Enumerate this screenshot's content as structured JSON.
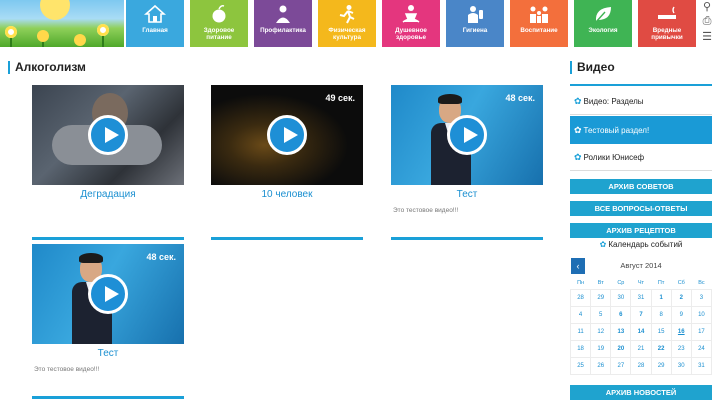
{
  "nav": {
    "tiles": [
      {
        "label": "Главная",
        "color": "#3aa8de",
        "icon": "house-icon"
      },
      {
        "label": "Здоровое питание",
        "color": "#8dc53e",
        "icon": "apple-icon"
      },
      {
        "label": "Профилактика",
        "color": "#7c4a98",
        "icon": "doctor-icon"
      },
      {
        "label": "Физическая культура",
        "color": "#f4b81c",
        "icon": "runner-icon"
      },
      {
        "label": "Душевное здоровье",
        "color": "#e4367e",
        "icon": "meditation-icon"
      },
      {
        "label": "Гигиена",
        "color": "#4a86c8",
        "icon": "hygiene-icon"
      },
      {
        "label": "Воспитание",
        "color": "#f36f3c",
        "icon": "family-icon"
      },
      {
        "label": "Экология",
        "color": "#3fb454",
        "icon": "leaf-icon"
      },
      {
        "label": "Вредные привычки",
        "color": "#e04b43",
        "icon": "no-smoking-icon"
      }
    ],
    "tools": [
      "search-icon",
      "print-icon",
      "sitemap-icon"
    ]
  },
  "main": {
    "title": "Алкоголизм",
    "videos": [
      {
        "title": "Деградация",
        "duration": "",
        "description": "",
        "thumb": "sleeping-man"
      },
      {
        "title": "10 человек",
        "duration": "49 сек.",
        "description": "",
        "thumb": "dark-bar"
      },
      {
        "title": "Тест",
        "duration": "48 сек.",
        "description": "Это тестовое видео!!!",
        "thumb": "man-in-suit"
      },
      {
        "title": "Тест",
        "duration": "48 сек.",
        "description": "Это тестовое видео!!!",
        "thumb": "man-in-suit"
      }
    ]
  },
  "sidebar": {
    "title": "Видео",
    "items": [
      {
        "label": "Видео: Разделы",
        "active": false
      },
      {
        "label": "Тестовый раздел!",
        "active": true
      },
      {
        "label": "Ролики Юнисеф",
        "active": false
      }
    ],
    "buttons": {
      "tips": "АРХИВ СОВЕТОВ",
      "qa": "ВСЕ ВОПРОСЫ-ОТВЕТЫ",
      "recipes": "АРХИВ РЕЦЕПТОВ",
      "news": "АРХИВ НОВОСТЕЙ"
    },
    "calendar": {
      "title": "Календарь событий",
      "month": "Август 2014",
      "prev": "‹",
      "dow": [
        "Пн",
        "Вт",
        "Ср",
        "Чт",
        "Пт",
        "Сб",
        "Вс"
      ],
      "weeks": [
        [
          "28",
          "29",
          "30",
          "31",
          "1",
          "2",
          "3"
        ],
        [
          "4",
          "5",
          "6",
          "7",
          "8",
          "9",
          "10"
        ],
        [
          "11",
          "12",
          "13",
          "14",
          "15",
          "16",
          "17"
        ],
        [
          "18",
          "19",
          "20",
          "21",
          "22",
          "23",
          "24"
        ],
        [
          "25",
          "26",
          "27",
          "28",
          "29",
          "30",
          "31"
        ]
      ]
    }
  }
}
